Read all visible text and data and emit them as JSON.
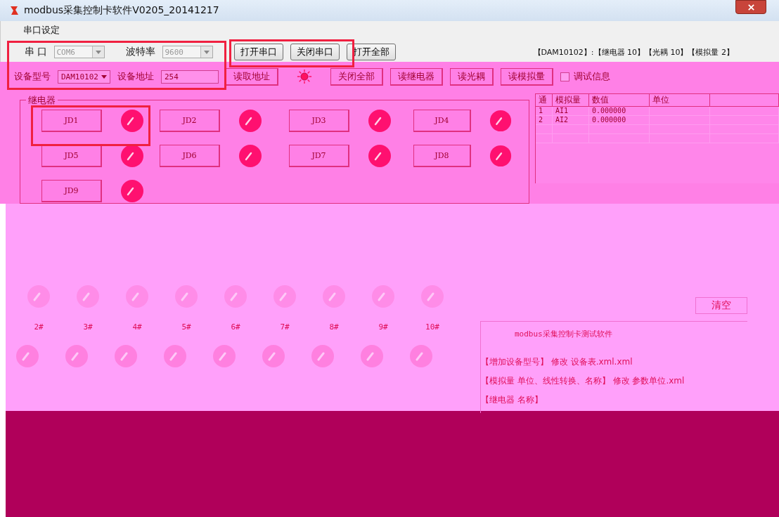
{
  "window": {
    "title": "modbus采集控制卡软件V0205_20141217"
  },
  "serial_settings": {
    "legend": "串口设定",
    "port_label": "串 口",
    "port": {
      "value": "COM6",
      "disabled": true
    },
    "baud_label": "波特率",
    "baud": {
      "value": "9600",
      "disabled": true
    },
    "buttons": [
      "打开串口",
      "关闭串口",
      "打开全部"
    ],
    "device_info": "【DAM10102】:【继电器 10】【光耦 10】【模拟量 2】",
    "model_label": "设备型号",
    "model": {
      "value": "DAM10102"
    },
    "address_label": "设备地址",
    "address": {
      "value": "254"
    },
    "read_address_button": "读取地址",
    "status_light": {
      "on": true
    },
    "buttons_2": [
      "关闭全部",
      "读继电器",
      "读光耦",
      "读模拟量"
    ],
    "debug_checkbox": {
      "label": "调试信息",
      "checked": false
    }
  },
  "relays": {
    "legend": "继电器",
    "items": [
      {
        "label": "JD1",
        "on": true
      },
      {
        "label": "JD2",
        "on": true
      },
      {
        "label": "JD3",
        "on": true
      },
      {
        "label": "JD4",
        "on": true
      },
      {
        "label": "JD5",
        "on": true
      },
      {
        "label": "JD6",
        "on": true
      },
      {
        "label": "JD7",
        "on": true
      },
      {
        "label": "JD8",
        "on": true
      },
      {
        "label": "JD9",
        "on": true
      }
    ]
  },
  "analog_table": {
    "columns": [
      "通",
      "模拟量",
      "数值",
      "单位"
    ],
    "rows": [
      {
        "channel": "1",
        "name": "AI1",
        "value": "0.000000"
      },
      {
        "channel": "2",
        "name": "AI2",
        "value": "0.000000"
      }
    ]
  },
  "inputs": [
    {
      "label": "2#",
      "on": false
    },
    {
      "label": "3#",
      "on": false
    },
    {
      "label": "4#",
      "on": false
    },
    {
      "label": "5#",
      "on": false
    },
    {
      "label": "6#",
      "on": false
    },
    {
      "label": "7#",
      "on": false
    },
    {
      "label": "8#",
      "on": false
    },
    {
      "label": "9#",
      "on": false
    },
    {
      "label": "10#",
      "on": false
    }
  ],
  "outputs": [
    {
      "on": false
    },
    {
      "on": false
    },
    {
      "on": false
    },
    {
      "on": false
    },
    {
      "on": false
    },
    {
      "on": false
    },
    {
      "on": false
    },
    {
      "on": false
    },
    {
      "on": false
    }
  ],
  "log": {
    "clear_button": "清空",
    "lines": [
      "modbus采集控制卡测试软件",
      "【增加设备型号】 修改  设备表.xml.xml",
      "【模拟量 单位、线性转换、名称】 修改 参数单位.xml",
      "【继电器 名称】"
    ]
  }
}
